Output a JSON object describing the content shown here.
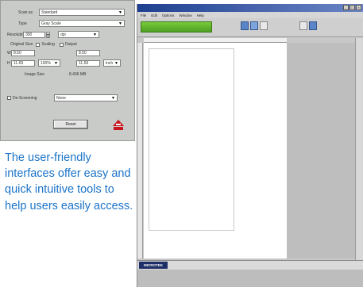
{
  "settings": {
    "scan_as_label": "Scan as",
    "scan_as_value": "Standard",
    "type_label": "Type",
    "type_value": "Gray Scale",
    "resolution_label": "Resolution",
    "resolution_value": "300",
    "resolution_unit": "dpi",
    "original_size_label": "Original Size",
    "scaling_label": "Scaling",
    "output_label": "Output",
    "w_label": "W",
    "h_label": "H",
    "orig_w_value": "8.50",
    "orig_h_value": "11.69",
    "scaling_value": "100%",
    "out_w_value": "8.50",
    "out_h_value": "11.69",
    "unit_value": "inch",
    "image_size_label": "Image Size",
    "image_size_value": "8.406 MB",
    "de_screening_label": "De-Screening",
    "de_screening_value": "None",
    "reset_label": "Reset"
  },
  "caption": "The user-friendly interfaces offer easy and quick intuitive tools to help users easily access.",
  "app": {
    "title": "",
    "menus": [
      "File",
      "Edit",
      "Options",
      "Window",
      "Help"
    ],
    "scan_button_label": "",
    "tool_labels": [
      "",
      "",
      ""
    ],
    "brand": "MICROTEK",
    "status_text": ""
  },
  "colors": {
    "caption": "#1a73c8",
    "scan_button": "#5fae2c",
    "title_bar": "#2b4a9a"
  }
}
